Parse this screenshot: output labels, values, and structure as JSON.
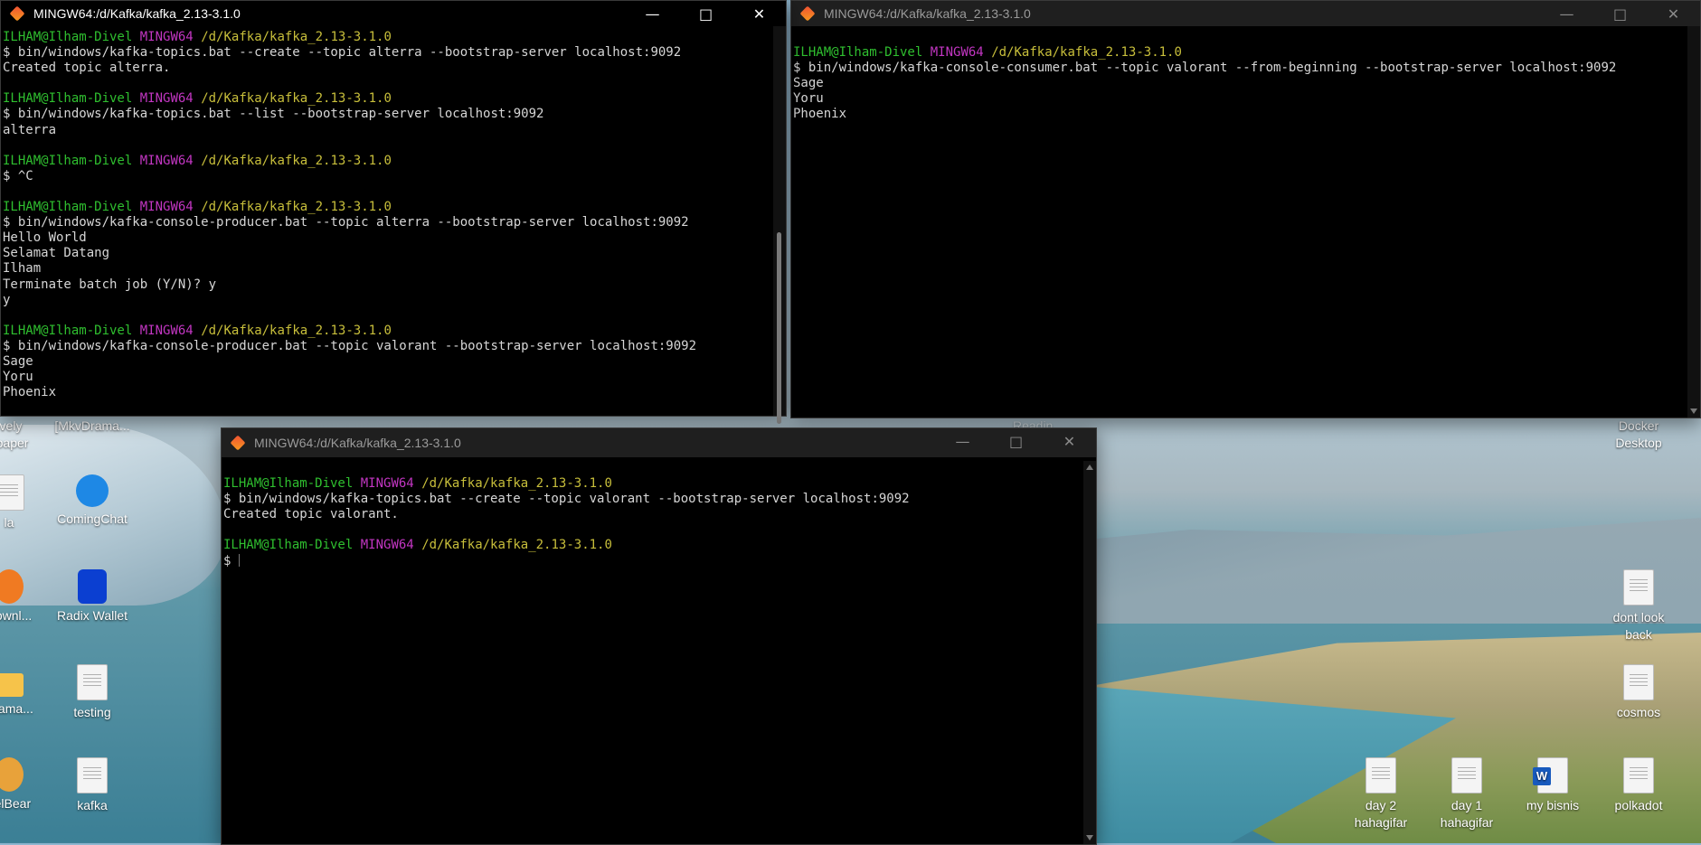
{
  "desktop_icons": [
    {
      "label": "vely\nlpaper",
      "kind": "none"
    },
    {
      "label": "[MkvDrama...",
      "kind": "none"
    },
    {
      "label": "Readin...",
      "kind": "none"
    },
    {
      "label": "Docker\nDesktop",
      "kind": "none"
    },
    {
      "label": "la",
      "kind": "doc"
    },
    {
      "label": "ComingChat",
      "kind": "app"
    },
    {
      "label": "Downl...",
      "kind": "app"
    },
    {
      "label": "Radix Wallet",
      "kind": "app"
    },
    {
      "label": "dont look\nback",
      "kind": "doc"
    },
    {
      "label": "Drama...",
      "kind": "folder"
    },
    {
      "label": "testing",
      "kind": "doc"
    },
    {
      "label": "cosmos",
      "kind": "doc"
    },
    {
      "label": "helBear",
      "kind": "app"
    },
    {
      "label": "kafka",
      "kind": "doc"
    },
    {
      "label": "day 2\nhahagifar",
      "kind": "doc"
    },
    {
      "label": "day 1\nhahagifar",
      "kind": "doc"
    },
    {
      "label": "my bisnis",
      "kind": "word"
    },
    {
      "label": "polkadot",
      "kind": "doc"
    }
  ],
  "colors": {
    "prompt_user": "#2fbf2f",
    "prompt_host": "#c236c2",
    "prompt_path": "#c8bf3b",
    "text": "#d6d6d6"
  },
  "windows": {
    "producer": {
      "title": "MINGW64:/d/Kafka/kafka_2.13-3.1.0",
      "lines": [
        {
          "type": "prompt",
          "user": "ILHAM@Ilham-Divel",
          "host": "MINGW64",
          "path": "/d/Kafka/kafka_2.13-3.1.0"
        },
        {
          "type": "text",
          "text": "$ bin/windows/kafka-topics.bat --create --topic alterra --bootstrap-server localhost:9092"
        },
        {
          "type": "text",
          "text": "Created topic alterra."
        },
        {
          "type": "text",
          "text": ""
        },
        {
          "type": "prompt",
          "user": "ILHAM@Ilham-Divel",
          "host": "MINGW64",
          "path": "/d/Kafka/kafka_2.13-3.1.0"
        },
        {
          "type": "text",
          "text": "$ bin/windows/kafka-topics.bat --list --bootstrap-server localhost:9092"
        },
        {
          "type": "text",
          "text": "alterra"
        },
        {
          "type": "text",
          "text": ""
        },
        {
          "type": "prompt",
          "user": "ILHAM@Ilham-Divel",
          "host": "MINGW64",
          "path": "/d/Kafka/kafka_2.13-3.1.0"
        },
        {
          "type": "text",
          "text": "$ ^C"
        },
        {
          "type": "text",
          "text": ""
        },
        {
          "type": "prompt",
          "user": "ILHAM@Ilham-Divel",
          "host": "MINGW64",
          "path": "/d/Kafka/kafka_2.13-3.1.0"
        },
        {
          "type": "text",
          "text": "$ bin/windows/kafka-console-producer.bat --topic alterra --bootstrap-server localhost:9092"
        },
        {
          "type": "text",
          "text": "Hello World"
        },
        {
          "type": "text",
          "text": "Selamat Datang"
        },
        {
          "type": "text",
          "text": "Ilham"
        },
        {
          "type": "text",
          "text": "Terminate batch job (Y/N)? y"
        },
        {
          "type": "text",
          "text": "y"
        },
        {
          "type": "text",
          "text": ""
        },
        {
          "type": "prompt",
          "user": "ILHAM@Ilham-Divel",
          "host": "MINGW64",
          "path": "/d/Kafka/kafka_2.13-3.1.0"
        },
        {
          "type": "text",
          "text": "$ bin/windows/kafka-console-producer.bat --topic valorant --bootstrap-server localhost:9092"
        },
        {
          "type": "text",
          "text": "Sage"
        },
        {
          "type": "text",
          "text": "Yoru"
        },
        {
          "type": "text",
          "text": "Phoenix"
        }
      ]
    },
    "consumer": {
      "title": "MINGW64:/d/Kafka/kafka_2.13-3.1.0",
      "lines": [
        {
          "type": "text",
          "text": ""
        },
        {
          "type": "prompt",
          "user": "ILHAM@Ilham-Divel",
          "host": "MINGW64",
          "path": "/d/Kafka/kafka_2.13-3.1.0"
        },
        {
          "type": "text",
          "text": "$ bin/windows/kafka-console-consumer.bat --topic valorant --from-beginning --bootstrap-server localhost:9092"
        },
        {
          "type": "text",
          "text": "Sage"
        },
        {
          "type": "text",
          "text": "Yoru"
        },
        {
          "type": "text",
          "text": "Phoenix"
        }
      ]
    },
    "topics": {
      "title": "MINGW64:/d/Kafka/kafka_2.13-3.1.0",
      "lines": [
        {
          "type": "text",
          "text": ""
        },
        {
          "type": "prompt",
          "user": "ILHAM@Ilham-Divel",
          "host": "MINGW64",
          "path": "/d/Kafka/kafka_2.13-3.1.0"
        },
        {
          "type": "text",
          "text": "$ bin/windows/kafka-topics.bat --create --topic valorant --bootstrap-server localhost:9092"
        },
        {
          "type": "text",
          "text": "Created topic valorant."
        },
        {
          "type": "text",
          "text": ""
        },
        {
          "type": "prompt",
          "user": "ILHAM@Ilham-Divel",
          "host": "MINGW64",
          "path": "/d/Kafka/kafka_2.13-3.1.0"
        },
        {
          "type": "cursor",
          "text": "$ "
        }
      ]
    }
  }
}
